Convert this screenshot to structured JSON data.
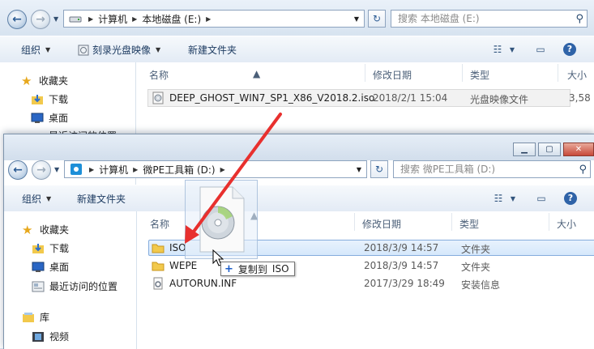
{
  "back_window": {
    "address": [
      "计算机",
      "本地磁盘 (E:)"
    ],
    "search_placeholder": "搜索 本地磁盘 (E:)",
    "toolbar": {
      "organize": "组织",
      "burn": "刻录光盘映像",
      "new_folder": "新建文件夹"
    },
    "sidebar": {
      "favorites": "收藏夹",
      "downloads": "下载",
      "desktop": "桌面",
      "recent": "最近访问的位置"
    },
    "columns": {
      "name": "名称",
      "date": "修改日期",
      "type": "类型",
      "size": "大小"
    },
    "files": [
      {
        "name": "DEEP_GHOST_WIN7_SP1_X86_V2018.2.iso",
        "date": "2018/2/1 15:04",
        "type": "光盘映像文件",
        "size": "3,58"
      }
    ]
  },
  "front_window": {
    "address": [
      "计算机",
      "微PE工具箱 (D:)"
    ],
    "search_placeholder": "搜索 微PE工具箱 (D:)",
    "toolbar": {
      "organize": "组织",
      "new_folder": "新建文件夹"
    },
    "sidebar": {
      "favorites": "收藏夹",
      "downloads": "下载",
      "desktop": "桌面",
      "recent": "最近访问的位置",
      "libraries": "库",
      "videos": "视频"
    },
    "columns": {
      "name": "名称",
      "date": "修改日期",
      "type": "类型",
      "size": "大小"
    },
    "files": [
      {
        "name": "ISO",
        "date": "2018/3/9 14:57",
        "type": "文件夹"
      },
      {
        "name": "WEPE",
        "date": "2018/3/9 14:57",
        "type": "文件夹"
      },
      {
        "name": "AUTORUN.INF",
        "date": "2017/3/29 18:49",
        "type": "安装信息"
      }
    ]
  },
  "drag_tooltip": {
    "action": "复制到",
    "target": "ISO"
  },
  "colors": {
    "accent": "#2a5a93",
    "arrow": "#e8302e",
    "folder": "#f2c94c"
  }
}
